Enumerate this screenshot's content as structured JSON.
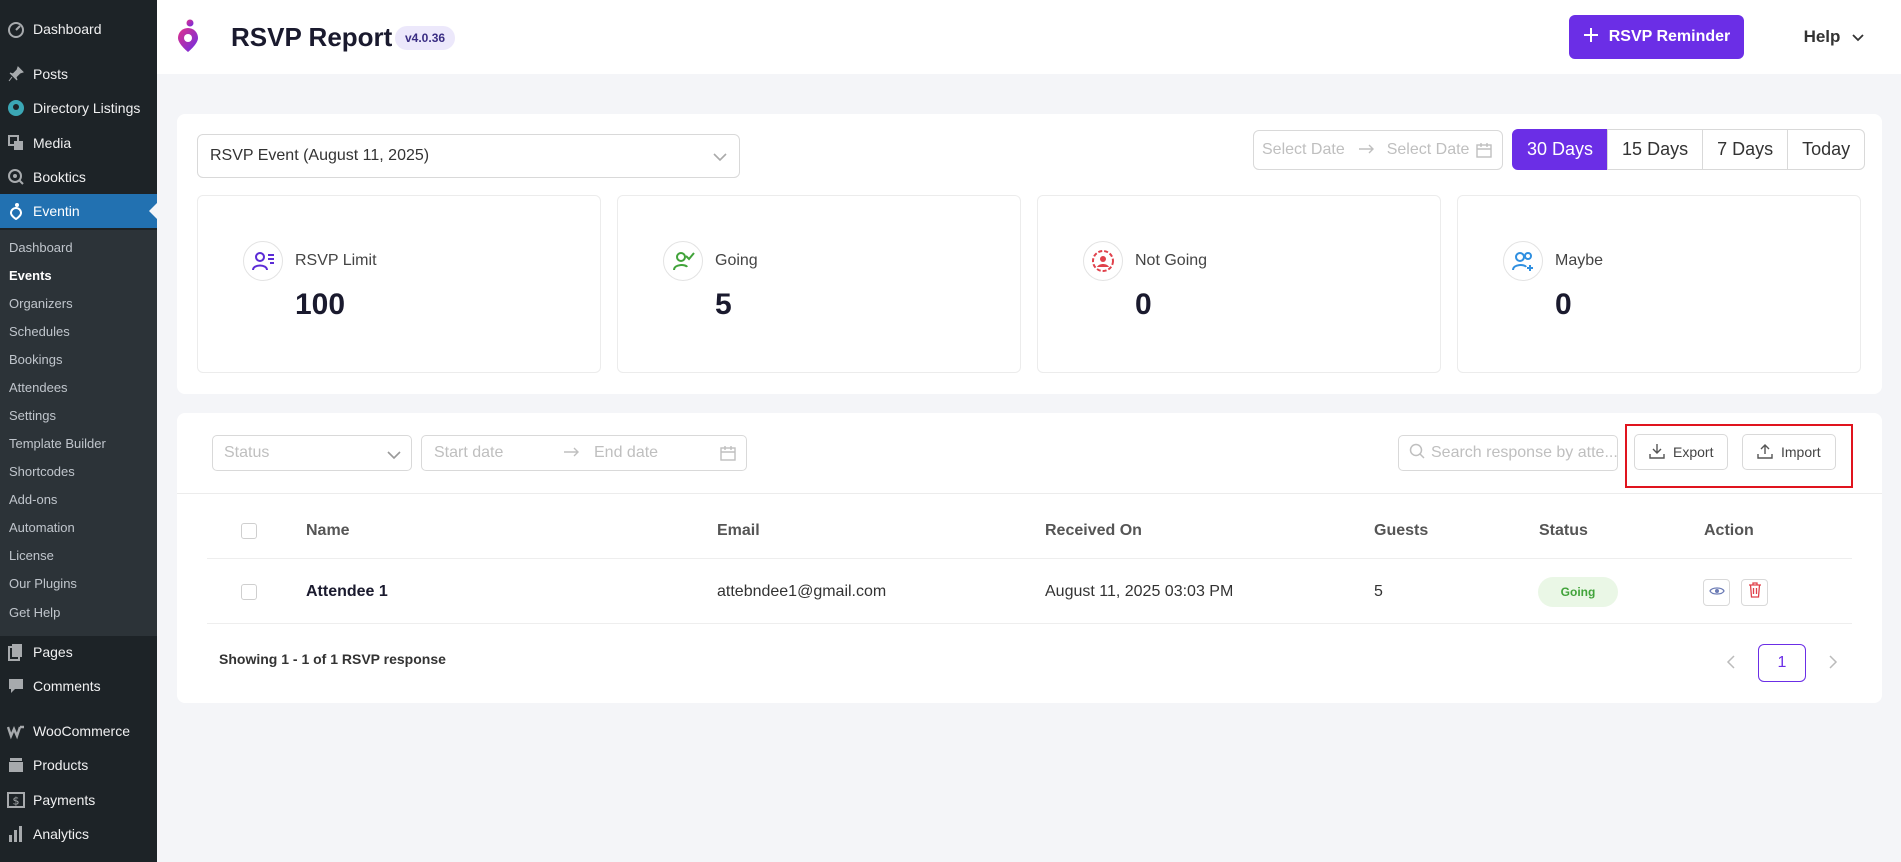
{
  "sidebar": {
    "top_items": [
      {
        "label": "Dashboard",
        "icon": "dashboard-icon"
      },
      {
        "label": "Posts",
        "icon": "pin-icon"
      },
      {
        "label": "Directory Listings",
        "icon": "directory-icon"
      },
      {
        "label": "Media",
        "icon": "media-icon"
      },
      {
        "label": "Booktics",
        "icon": "booktics-icon"
      },
      {
        "label": "Eventin",
        "icon": "eventin-icon"
      }
    ],
    "submenu": [
      "Dashboard",
      "Events",
      "Organizers",
      "Schedules",
      "Bookings",
      "Attendees",
      "Settings",
      "Template Builder",
      "Shortcodes",
      "Add-ons",
      "Automation",
      "License",
      "Our Plugins",
      "Get Help"
    ],
    "bottom_items": [
      {
        "label": "Pages",
        "icon": "pages-icon"
      },
      {
        "label": "Comments",
        "icon": "comments-icon"
      },
      {
        "label": "WooCommerce",
        "icon": "woocommerce-icon"
      },
      {
        "label": "Products",
        "icon": "products-icon"
      },
      {
        "label": "Payments",
        "icon": "payments-icon"
      },
      {
        "label": "Analytics",
        "icon": "analytics-icon"
      }
    ]
  },
  "header": {
    "title": "RSVP Report",
    "version": "v4.0.36",
    "reminder_button": "RSVP Reminder",
    "help_button": "Help"
  },
  "filters": {
    "event_selected": "RSVP Event (August 11, 2025)",
    "start_placeholder": "Select Date",
    "end_placeholder": "Select Date",
    "periods": [
      "30 Days",
      "15 Days",
      "7 Days",
      "Today"
    ],
    "active_period": "30 Days"
  },
  "stats": [
    {
      "label": "RSVP Limit",
      "value": "100",
      "icon": "rsvp-limit-icon",
      "color": "#5b2bd6"
    },
    {
      "label": "Going",
      "value": "5",
      "icon": "going-icon",
      "color": "#41a33a"
    },
    {
      "label": "Not Going",
      "value": "0",
      "icon": "not-going-icon",
      "color": "#e0414b"
    },
    {
      "label": "Maybe",
      "value": "0",
      "icon": "maybe-icon",
      "color": "#2f8fe0"
    }
  ],
  "table_filters": {
    "status_placeholder": "Status",
    "start_date_placeholder": "Start date",
    "end_date_placeholder": "End date",
    "search_placeholder": "Search response by atte...",
    "export_label": "Export",
    "import_label": "Import"
  },
  "table": {
    "columns": [
      "Name",
      "Email",
      "Received On",
      "Guests",
      "Status",
      "Action"
    ],
    "rows": [
      {
        "name": "Attendee 1",
        "email": "attebndee1@gmail.com",
        "received_on": "August 11, 2025 03:03 PM",
        "guests": "5",
        "status": "Going"
      }
    ]
  },
  "pagination": {
    "summary": "Showing 1 - 1 of 1 RSVP response",
    "current_page": "1"
  },
  "colors": {
    "accent": "#6b2ee6",
    "wp_sidebar": "#1d2327",
    "wp_highlight": "#2271b1",
    "going_green": "#41a33a",
    "delete_red": "#e0414b"
  }
}
